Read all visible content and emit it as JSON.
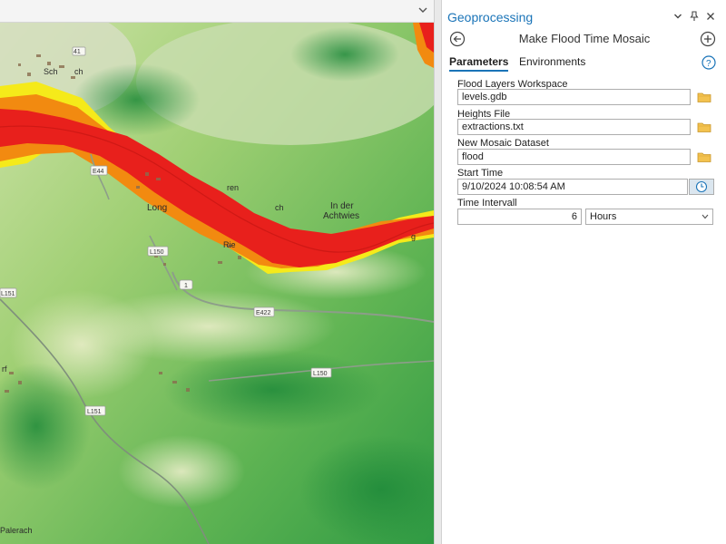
{
  "map": {
    "places": [
      "Long",
      "In der",
      "Achtwies",
      "ren",
      "ch",
      "Rie",
      "rf",
      "Palerach",
      "Sch",
      "ch",
      "g"
    ],
    "roads": [
      "E44",
      "L150",
      "1",
      "E422",
      "L151",
      "L150",
      "L151",
      "41"
    ]
  },
  "gp": {
    "title": "Geoprocessing",
    "tool_name": "Make Flood Time Mosaic",
    "tabs": [
      "Parameters",
      "Environments"
    ],
    "params": {
      "workspace_label": "Flood Layers Workspace",
      "workspace_value": "levels.gdb",
      "heights_label": "Heights File",
      "heights_value": "extractions.txt",
      "mosaic_label": "New Mosaic Dataset",
      "mosaic_value": "flood",
      "start_label": "Start Time",
      "start_value": "9/10/2024 10:08:54 AM",
      "interval_label": "Time Intervall",
      "interval_value": "6",
      "interval_unit": "Hours"
    },
    "icons": {
      "dropdown": "chevron-down-icon",
      "pin": "pin-icon",
      "close": "close-icon",
      "back": "back-arrow-icon",
      "add": "plus-circle-icon",
      "help": "help-icon",
      "folder": "folder-icon",
      "clock": "clock-icon"
    },
    "colors": {
      "accent": "#1a74b8",
      "flood_red": "#e8201c",
      "flood_orange": "#f28a10",
      "flood_yellow": "#f5ea1a"
    }
  }
}
